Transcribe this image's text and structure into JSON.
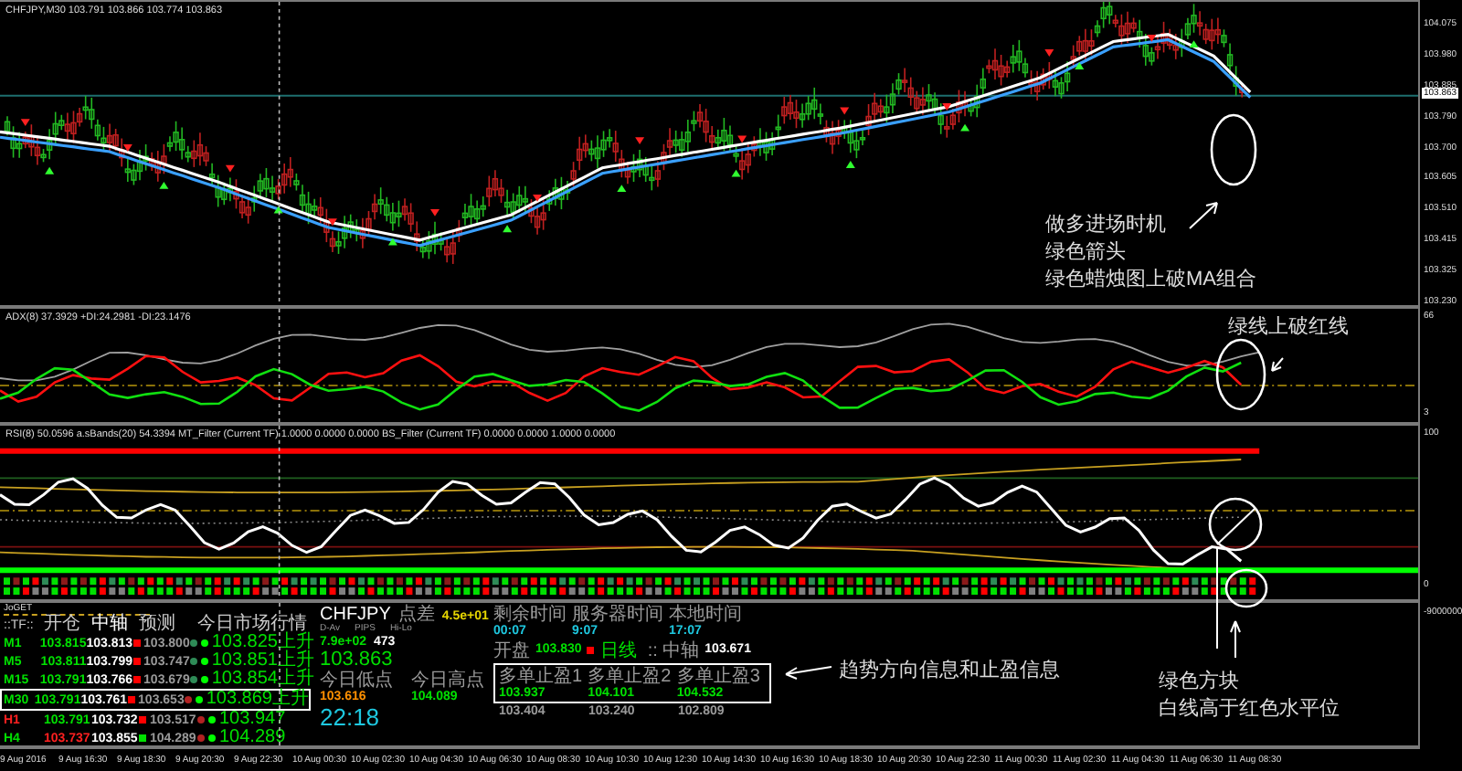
{
  "chart": {
    "header": "CHFJPY,M30  103.791 103.866 103.774 103.863",
    "price_ticks": [
      "104.075",
      "103.980",
      "103.885",
      "103.790",
      "103.700",
      "103.605",
      "103.510",
      "103.415",
      "103.325",
      "103.230"
    ],
    "current_price": "103.863"
  },
  "adx": {
    "label": "ADX(8) 37.3929 +DI:24.2981 -DI:23.1476",
    "ticks": [
      "66",
      "3"
    ]
  },
  "rsi": {
    "label": "RSI(8) 50.0596  a.sBands(20) 54.3394  MT_Filter (Current TF) 1.0000 0.0000 0.0000  BS_Filter (Current TF) 0.0000 0.0000 1.0000 0.0000",
    "ticks": [
      "100",
      "0"
    ]
  },
  "blocks": {
    "ticks": [
      "-9000000"
    ]
  },
  "annotations": [
    {
      "lines": [
        "做多进场时机",
        "绿色箭头",
        "绿色蜡烛图上破MA组合"
      ]
    },
    {
      "lines": [
        "绿线上破红线"
      ]
    },
    {
      "lines": [
        "趋势方向信息和止盈信息"
      ]
    },
    {
      "lines": [
        "绿色方块",
        "白线高于红色水平位"
      ]
    }
  ],
  "table": {
    "title": "JoGET",
    "columns": [
      "::TF::",
      "开仓",
      "中轴",
      "预测",
      "今日市场行情"
    ],
    "rows": [
      {
        "tf": {
          "text": "M1",
          "color": "#00e000"
        },
        "open": {
          "text": "103.815",
          "color": "#00e000"
        },
        "mid": "103.813",
        "signal": {
          "color": "#ff0000"
        },
        "forecast": "103.800",
        "dots": [
          {
            "color": "#2e8b57"
          },
          {
            "color": "#00ff00"
          }
        ],
        "market": "103.825上升",
        "selected": false
      },
      {
        "tf": {
          "text": "M5",
          "color": "#00e000"
        },
        "open": {
          "text": "103.811",
          "color": "#00e000"
        },
        "mid": "103.799",
        "signal": {
          "color": "#ff0000"
        },
        "forecast": "103.747",
        "dots": [
          {
            "color": "#2e8b57"
          },
          {
            "color": "#00ff00"
          }
        ],
        "market": "103.851上升",
        "selected": false
      },
      {
        "tf": {
          "text": "M15",
          "color": "#00e000"
        },
        "open": {
          "text": "103.791",
          "color": "#00e000"
        },
        "mid": "103.766",
        "signal": {
          "color": "#ff0000"
        },
        "forecast": "103.679",
        "dots": [
          {
            "color": "#2e8b57"
          },
          {
            "color": "#00ff00"
          }
        ],
        "market": "103.854上升",
        "selected": false
      },
      {
        "tf": {
          "text": "M30",
          "color": "#00e000"
        },
        "open": {
          "text": "103.791",
          "color": "#00e000"
        },
        "mid": "103.761",
        "signal": {
          "color": "#ff0000"
        },
        "forecast": "103.653",
        "dots": [
          {
            "color": "#b22222"
          },
          {
            "color": "#00ff00"
          }
        ],
        "market": "103.869上升",
        "selected": true
      },
      {
        "tf": {
          "text": "H1",
          "color": "#ff2020"
        },
        "open": {
          "text": "103.791",
          "color": "#00e000"
        },
        "mid": "103.732",
        "signal": {
          "color": "#ff0000"
        },
        "forecast": "103.517",
        "dots": [
          {
            "color": "#b22222"
          },
          {
            "color": "#00ff00"
          }
        ],
        "market": "103.947",
        "selected": false
      },
      {
        "tf": {
          "text": "H4",
          "color": "#00e000"
        },
        "open": {
          "text": "103.737",
          "color": "#ff2020"
        },
        "mid": "103.855",
        "signal": {
          "color": "#00e000"
        },
        "forecast": "104.289",
        "dots": [
          {
            "color": "#b22222"
          },
          {
            "color": "#00ff00"
          }
        ],
        "market": "104.289",
        "selected": false
      }
    ]
  },
  "quote": {
    "symbol": "CHFJPY",
    "spread_label": "点差",
    "spread": "4.5e+01",
    "col_labels": [
      "D-Av",
      "PIPS",
      "Hi-Lo"
    ],
    "d_av": "7.9e+02",
    "hi_lo": "473",
    "price": "103.863",
    "low_label": "今日低点",
    "high_label": "今日高点",
    "low": "103.616",
    "high": "104.089",
    "clock": "22:18"
  },
  "times": [
    {
      "label": "剩余时间",
      "value": "00:07"
    },
    {
      "label": "服务器时间",
      "value": "9:07"
    },
    {
      "label": "本地时间",
      "value": "17:07"
    }
  ],
  "open": {
    "label": "开盘",
    "value": "103.830",
    "tag": "日线"
  },
  "pivot": {
    "label": ":: 中轴",
    "value": "103.671"
  },
  "targets": {
    "labels": [
      "多单止盈1",
      "多单止盈2",
      "多单止盈3"
    ],
    "long": [
      "103.937",
      "104.101",
      "104.532"
    ],
    "short": [
      "103.404",
      "103.240",
      "102.809"
    ]
  },
  "time_axis": [
    "9 Aug 2016",
    "9 Aug 16:30",
    "9 Aug 18:30",
    "9 Aug 20:30",
    "9 Aug 22:30",
    "10 Aug 00:30",
    "10 Aug 02:30",
    "10 Aug 04:30",
    "10 Aug 06:30",
    "10 Aug 08:30",
    "10 Aug 10:30",
    "10 Aug 12:30",
    "10 Aug 14:30",
    "10 Aug 16:30",
    "10 Aug 18:30",
    "10 Aug 20:30",
    "10 Aug 22:30",
    "11 Aug 00:30",
    "11 Aug 02:30",
    "11 Aug 04:30",
    "11 Aug 06:30",
    "11 Aug 08:30"
  ]
}
